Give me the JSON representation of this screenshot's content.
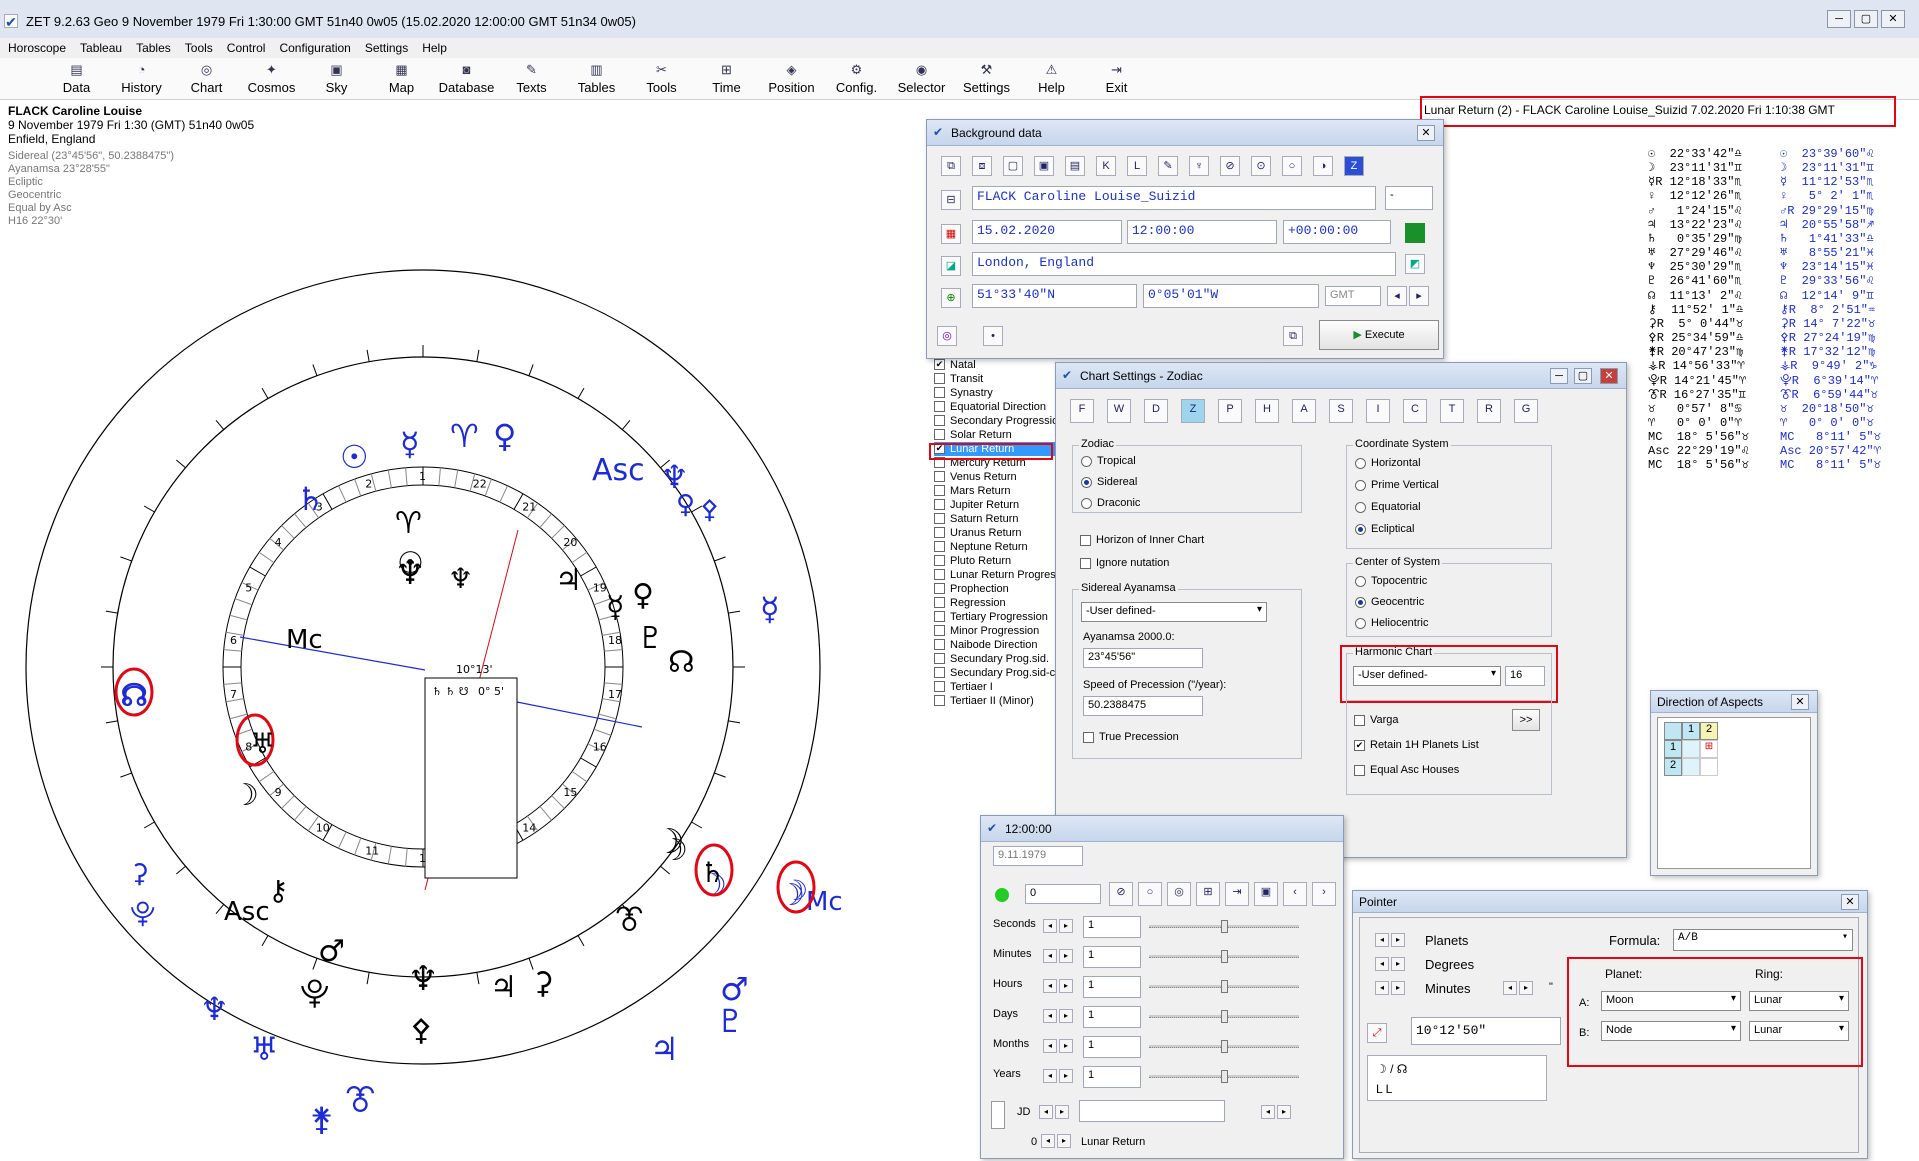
{
  "window": {
    "title": "ZET 9.2.63 Geo    9 November 1979  Fri   1:30:00 GMT 51n40  0w05   (15.02.2020  12:00:00 GMT 51n34 0w05)"
  },
  "menu": [
    "Horoscope",
    "Tableau",
    "Tables",
    "Tools",
    "Control",
    "Configuration",
    "Settings",
    "Help"
  ],
  "toolbar": [
    "Data",
    "History",
    "Chart",
    "Cosmos",
    "Sky",
    "Map",
    "Database",
    "Texts",
    "Tables",
    "Tools",
    "Time",
    "Position",
    "Config.",
    "Selector",
    "Settings",
    "Help",
    "Exit"
  ],
  "info": {
    "name": "FLACK Caroline Louise",
    "date": "9 November 1979  Fri   1:30 (GMT) 51n40  0w05",
    "place": "Enfield, England",
    "lines": [
      "Sidereal (23°45'56\", 50.2388475\")",
      "Ayanamsa 23°28'55\"",
      "Ecliptic",
      "Geocentric",
      "Equal by Asc",
      "H16  22°30'"
    ]
  },
  "chart": {
    "houses": [
      "1",
      "2",
      "3",
      "4",
      "5",
      "6",
      "7",
      "8",
      "9",
      "10",
      "11",
      "12",
      "13",
      "14",
      "15",
      "16",
      "17",
      "18",
      "19",
      "20",
      "21",
      "22"
    ],
    "box_deg": "10°13'",
    "box_text": "0° 5'",
    "box_glyphs": "♄ ♄ ☋"
  },
  "lunar_return_header": "Lunar Return (2) - FLACK Caroline Louise_Suizid  7.02.2020  Fri  1:10:38 GMT",
  "positions_left": [
    "☉  22°33'42\"♎",
    "☽  23°11'31\"♊",
    "☿R 12°18'33\"♏",
    "♀  12°12'26\"♏",
    "♂   1°24'15\"♌",
    "♃  13°22'23\"♌",
    "♄   0°35'29\"♍",
    "♅  27°29'46\"♌",
    "♆  25°30'29\"♏",
    "♇  26°41'60\"♏",
    "☊  11°13' 2\"♌",
    "⚷  11°52' 1\"♎",
    "⚳R  5° 0'44\"♉",
    "⚴R 25°34'59\"♎",
    "⚵R 20°47'23\"♍",
    "⚶R 14°56'33\"♈",
    "⯓R 14°21'45\"♈",
    "⯔R 16°27'35\"♊",
    "♉   0°57' 8\"♋",
    "♈   0° 0' 0\"♈",
    "MC  18° 5'56\"♉",
    "Asc 22°29'19\"♌",
    "MC  18° 5'56\"♉"
  ],
  "positions_right": [
    "☉  23°39'60\"♌",
    "☽  23°11'31\"♊",
    "☿  11°12'53\"♏",
    "♀   5° 2' 1\"♏",
    "♂R 29°29'15\"♍",
    "♃  20°55'58\"♐",
    "♄   1°41'33\"♎",
    "♅   8°55'21\"♓",
    "♆  23°14'15\"♓",
    "♇  29°33'56\"♌",
    "☊  12°14' 9\"♊",
    "⚷R  8° 2'51\"♒",
    "⚳R 14° 7'22\"♉",
    "⚴R 27°24'19\"♍",
    "⚵R 17°32'12\"♍",
    "⚶R  9°49' 2\"♑",
    "⯓R  6°39'14\"♈",
    "⯔R  6°59'44\"♉",
    "♉  20°18'50\"♉",
    "♈   0° 0' 0\"♉",
    "MC   8°11' 5\"♉",
    "Asc 20°57'42\"♈",
    "MC   8°11' 5\"♉"
  ],
  "background_data": {
    "title": "Background data",
    "name": "FLACK Caroline Louise_Suizid",
    "dash": "-",
    "date": "15.02.2020",
    "time": "12:00:00",
    "offset": "+00:00:00",
    "place": "London, England",
    "lat": "51°33'40\"N",
    "lon": "0°05'01\"W",
    "tz": "GMT",
    "execute": "Execute"
  },
  "chart_types": [
    "Natal",
    "Transit",
    "Synastry",
    "Equatorial Direction",
    "Secondary Progression",
    "Solar Return",
    "Lunar Return",
    "Mercury Return",
    "Venus Return",
    "Mars Return",
    "Jupiter Return",
    "Saturn Return",
    "Uranus Return",
    "Neptune Return",
    "Pluto Return",
    "Lunar Return Progress",
    "Prophection",
    "Regression",
    "Tertiary Progression",
    "Minor Progression",
    "Naibode Direction",
    "Secundary Prog.sid.",
    "Secundary Prog.sid-c",
    "Tertiaer I",
    "Tertiaer II (Minor)"
  ],
  "chart_settings": {
    "title": "Chart Settings - Zodiac",
    "tabs": [
      "F",
      "W",
      "D",
      "Z",
      "P",
      "H",
      "A",
      "S",
      "I",
      "C",
      "T",
      "R",
      "G"
    ],
    "zodiac_label": "Zodiac",
    "zodiac": [
      "Tropical",
      "Sidereal",
      "Draconic"
    ],
    "horizon": "Horizon of Inner Chart",
    "ignore_nutation": "Ignore nutation",
    "sidereal_label": "Sidereal Ayanamsa",
    "ayan_select": "-User defined-",
    "ayan2000_label": "Ayanamsa 2000.0:",
    "ayan2000": "23°45'56\"",
    "speed_label": "Speed of Precession (\"/year):",
    "speed": "50.2388475",
    "true_precession": "True Precession",
    "coord_label": "Coordinate System",
    "coords": [
      "Horizontal",
      "Prime Vertical",
      "Equatorial",
      "Ecliptical"
    ],
    "center_label": "Center of System",
    "centers": [
      "Topocentric",
      "Geocentric",
      "Heliocentric"
    ],
    "harmonic_label": "Harmonic Chart",
    "harmonic_select": "-User defined-",
    "harmonic_value": "16",
    "varga": "Varga",
    "more": ">>",
    "retain": "Retain 1H Planets List",
    "equal_asc": "Equal Asc Houses"
  },
  "time_window": {
    "title": "12:00:00",
    "date": "9.11.1979",
    "step": "0",
    "rows": [
      "Seconds",
      "Minutes",
      "Hours",
      "Days",
      "Months",
      "Years"
    ],
    "values": [
      "1",
      "1",
      "1",
      "1",
      "1",
      "1"
    ],
    "jd": "JD",
    "zero": "0",
    "bottom": "Lunar Return"
  },
  "aspects": {
    "title": "Direction of Aspects",
    "cols": [
      "1",
      "2"
    ],
    "rows": [
      "1",
      "2"
    ]
  },
  "pointer": {
    "title": "Pointer",
    "planets": "Planets",
    "degrees": "Degrees",
    "minutes": "Minutes",
    "sec": "\"",
    "formula_label": "Formula:",
    "formula": "A/B",
    "planet_label": "Planet:",
    "ring_label": "Ring:",
    "a_label": "A:",
    "b_label": "B:",
    "a_planet": "Moon",
    "b_planet": "Node",
    "a_ring": "Lunar",
    "b_ring": "Lunar",
    "value": "10°12'50\"",
    "formula_glyph": "☽ / ☊",
    "ll": "L   L"
  }
}
